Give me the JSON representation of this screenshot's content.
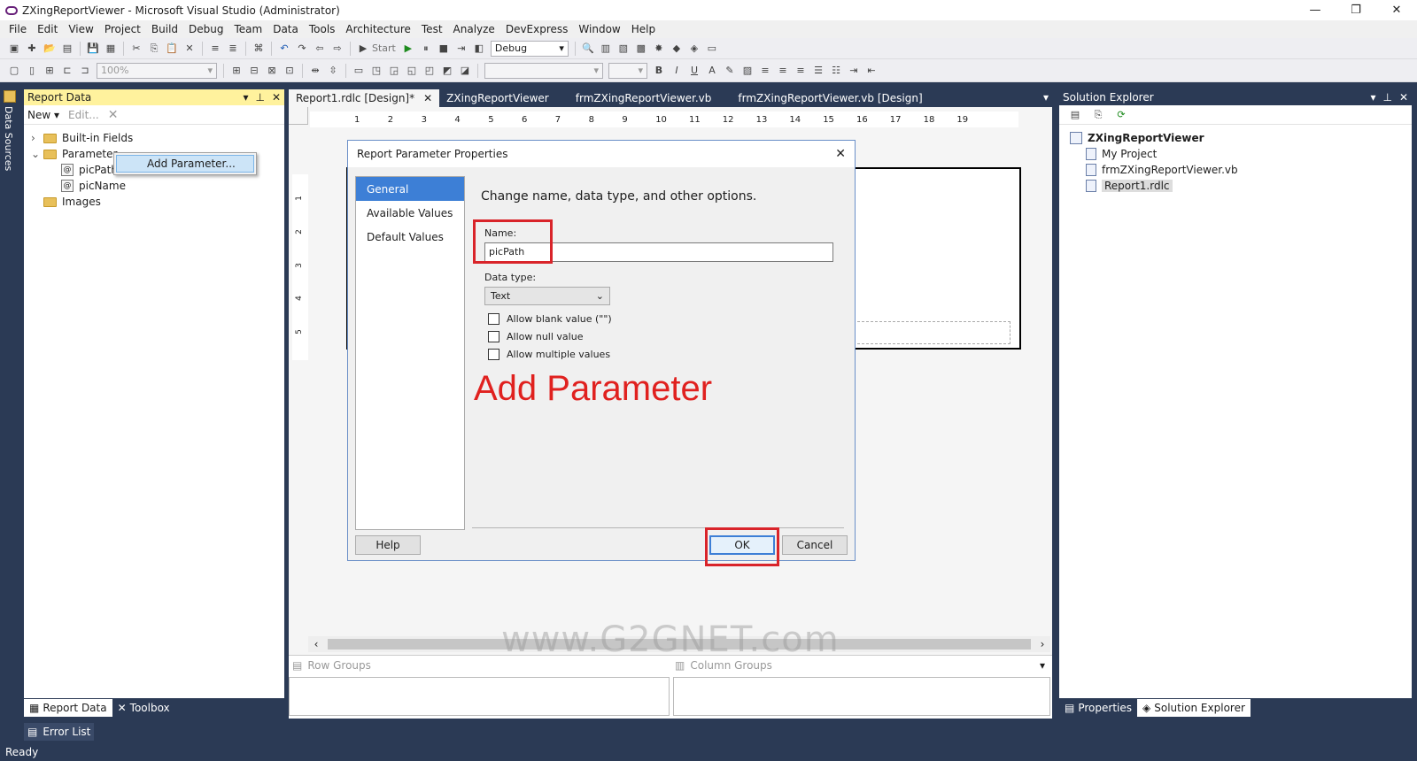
{
  "window": {
    "title": "ZXingReportViewer - Microsoft Visual Studio (Administrator)"
  },
  "menu": [
    "File",
    "Edit",
    "View",
    "Project",
    "Build",
    "Debug",
    "Team",
    "Data",
    "Tools",
    "Architecture",
    "Test",
    "Analyze",
    "DevExpress",
    "Window",
    "Help"
  ],
  "toolbar": {
    "start_label": "Start",
    "config": "Debug",
    "zoom": "100%"
  },
  "report_data": {
    "title": "Report Data",
    "new_label": "New",
    "edit_label": "Edit...",
    "tree": {
      "builtin": "Built-in Fields",
      "parameters": "Parameter",
      "param_items": [
        "picPath",
        "picName"
      ],
      "images": "Images"
    },
    "context_menu": {
      "add_parameter": "Add Parameter..."
    }
  },
  "left_sidebar": {
    "data_sources": "Data Sources"
  },
  "tabs": [
    {
      "label": "Report1.rdlc [Design]*",
      "active": true
    },
    {
      "label": "ZXingReportViewer",
      "active": false
    },
    {
      "label": "frmZXingReportViewer.vb",
      "active": false
    },
    {
      "label": "frmZXingReportViewer.vb [Design]",
      "active": false
    }
  ],
  "ruler": {
    "numbers": [
      "1",
      "2",
      "3",
      "4",
      "5",
      "6",
      "7",
      "8",
      "9",
      "10",
      "11",
      "12",
      "13",
      "14",
      "15",
      "16",
      "17",
      "18",
      "19"
    ],
    "vnumbers": [
      "1",
      "2",
      "3",
      "4",
      "5"
    ]
  },
  "dialog": {
    "title": "Report Parameter Properties",
    "nav": [
      "General",
      "Available Values",
      "Default Values"
    ],
    "heading": "Change name, data type, and other options.",
    "name_label": "Name:",
    "name_value": "picPath",
    "datatype_label": "Data type:",
    "datatype_value": "Text",
    "checkboxes": [
      "Allow blank value (\"\")",
      "Allow null value",
      "Allow multiple values"
    ],
    "annotation": "Add Parameter",
    "help": "Help",
    "ok": "OK",
    "cancel": "Cancel"
  },
  "groups": {
    "row": "Row Groups",
    "column": "Column Groups"
  },
  "watermark": "www.G2GNET.com",
  "solution_explorer": {
    "title": "Solution Explorer",
    "project": "ZXingReportViewer",
    "items": [
      "My Project",
      "frmZXingReportViewer.vb",
      "Report1.rdlc"
    ]
  },
  "bottom_tabs": {
    "report_data": "Report Data",
    "toolbox": "Toolbox",
    "properties": "Properties",
    "solution_explorer": "Solution Explorer",
    "error_list": "Error List"
  },
  "status": {
    "text": "Ready"
  }
}
